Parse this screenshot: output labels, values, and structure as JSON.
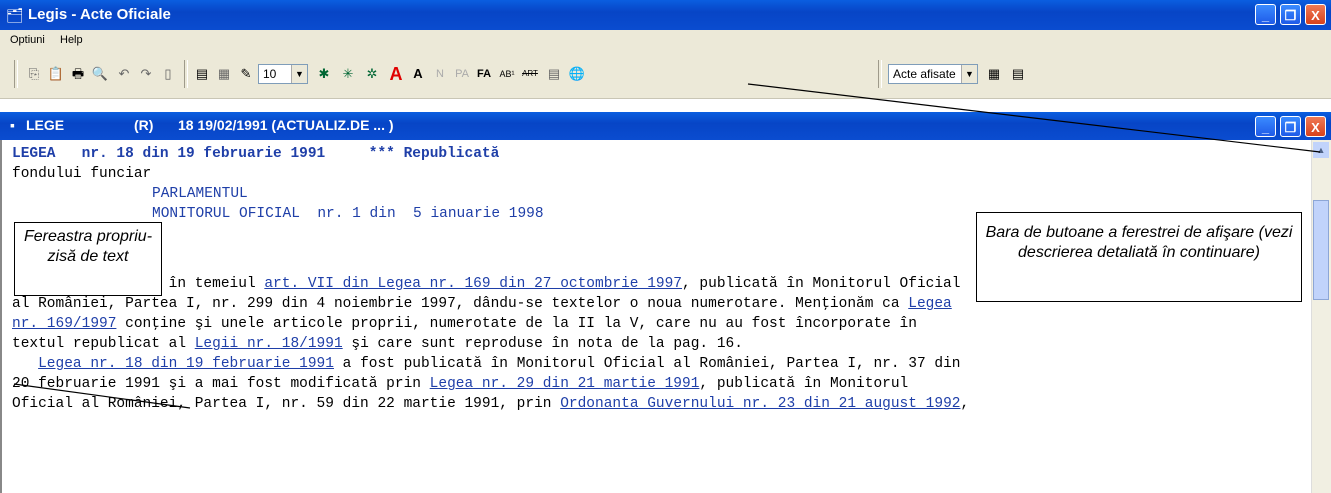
{
  "window": {
    "title": "Legis - Acte Oficiale",
    "minimize": "_",
    "restore": "❐",
    "close": "X"
  },
  "menu": {
    "items": [
      "Optiuni",
      "Help"
    ]
  },
  "toolbar": {
    "font_size": "10",
    "acte_label": "Acte afisate",
    "a_red": "A",
    "a_bold": "A",
    "n": "N",
    "pa": "PA",
    "fa": "FA",
    "ab": "AB¹",
    "art": "ART"
  },
  "doc_window": {
    "type": "LEGE",
    "r": "(R)",
    "ref": "18 19/02/1991 (ACTUALIZ.DE ... )"
  },
  "content": {
    "l1a": "LEGEA   nr. 18 din 19 februarie 1991",
    "l1b": "*** Republicată",
    "l2": "fondului funciar",
    "l3": "PARLAMENTUL",
    "l4": "MONITORUL OFICIAL  nr. 1 din  5 ianuarie 1998",
    "l5": "-------------",
    "p1a": "   *) Republicată în temeiul ",
    "p1link": "art. VII din Legea nr. 169 din 27 octombrie 1997",
    "p1b": ", publicată în Monitorul Oficial",
    "p2a": "al României, Partea I, nr. 299 din 4 noiembrie 1997, dându-se textelor o noua numerotare. Menţionăm ca ",
    "p2link": "Legea",
    "p3link": "nr. 169/1997",
    "p3b": " conţine şi unele articole proprii, numerotate de la II la V, care nu au fost încorporate în",
    "p4a": "textul republicat al ",
    "p4link": "Legii nr. 18/1991",
    "p4b": " şi care sunt reproduse în nota de la pag. 16.",
    "p5a": "   ",
    "p5link": "Legea nr. 18 din 19 februarie 1991",
    "p5b": " a fost publicată în Monitorul Oficial al României, Partea I, nr. 37 din",
    "p6a": "20 februarie 1991 şi a mai fost modificată prin ",
    "p6link": "Legea nr. 29 din 21 martie 1991",
    "p6b": ", publicată în Monitorul",
    "p7a": "Oficial al României, Partea I, nr. 59 din 22 martie 1991, prin ",
    "p7link": "Ordonanta Guvernului nr. 23 din 21 august 1992",
    "p7b": ","
  },
  "callouts": {
    "left": "Fereastra propriu-zisă de text",
    "right": "Bara de butoane a ferestrei de afişare (vezi descrierea detaliată în  continuare)"
  },
  "colors": {
    "title_bar": "#0a4cd0",
    "link": "#1f3fa8",
    "toolbar_bg": "#ece9d8"
  }
}
